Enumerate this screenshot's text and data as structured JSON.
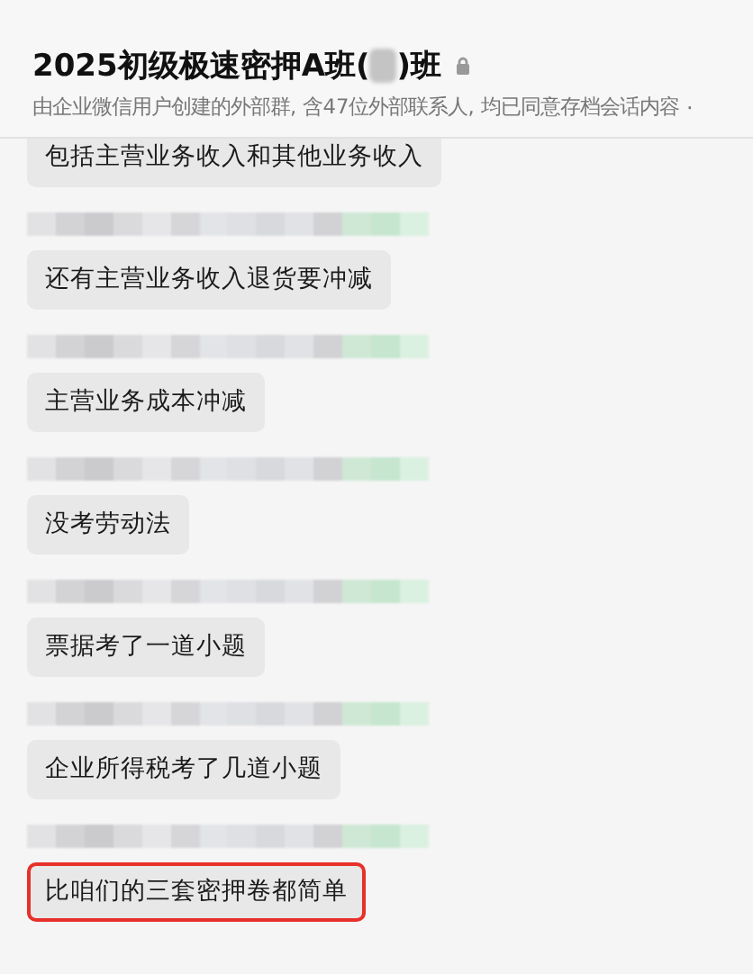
{
  "header": {
    "title_start": "2025初级极速密押A班(",
    "title_end": ")班",
    "subtitle": "由企业微信用户创建的外部群, 含47位外部联系人, 均已同意存档会话内容",
    "more": "·"
  },
  "messages": [
    {
      "text": "包括主营业务收入和其他业务收入",
      "highlighted": false
    },
    {
      "text": "还有主营业务收入退货要冲减",
      "highlighted": false
    },
    {
      "text": "主营业务成本冲减",
      "highlighted": false
    },
    {
      "text": "没考劳动法",
      "highlighted": false
    },
    {
      "text": "票据考了一道小题",
      "highlighted": false
    },
    {
      "text": "企业所得税考了几道小题",
      "highlighted": false
    },
    {
      "text": "比咱们的三套密押卷都简单",
      "highlighted": true
    }
  ]
}
